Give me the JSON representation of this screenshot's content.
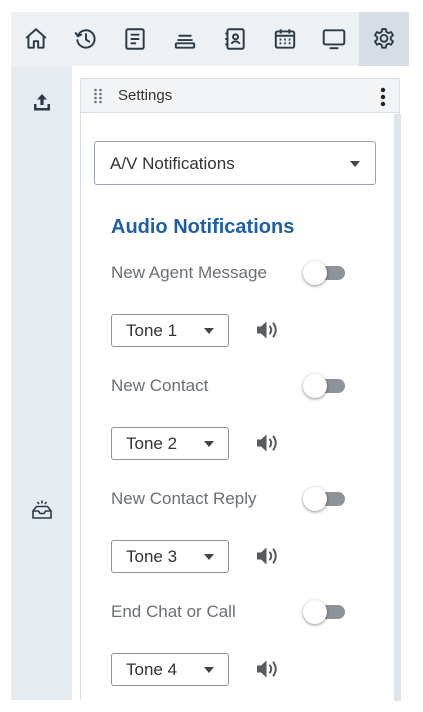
{
  "toolbar": {
    "icons": [
      "home-icon",
      "history-icon",
      "notes-icon",
      "queue-icon",
      "contacts-icon",
      "calendar-icon",
      "monitor-icon",
      "gear-icon"
    ],
    "active": "gear-icon"
  },
  "rail": {
    "icons": [
      "upload-icon",
      "inbox-icon"
    ]
  },
  "panel": {
    "title": "Settings",
    "menu_icon": "more-vertical-icon"
  },
  "category_select": {
    "value": "A/V Notifications"
  },
  "audio": {
    "heading": "Audio Notifications",
    "items": [
      {
        "label": "New Agent Message",
        "enabled": false,
        "tone": "Tone 1"
      },
      {
        "label": "New Contact",
        "enabled": false,
        "tone": "Tone 2"
      },
      {
        "label": "New Contact Reply",
        "enabled": false,
        "tone": "Tone 3"
      },
      {
        "label": "End Chat or Call",
        "enabled": false,
        "tone": "Tone 4"
      }
    ]
  },
  "colors": {
    "accent": "#1f5fa8",
    "toolbar_bg": "#eef1f4",
    "active_bg": "#d6dde4"
  }
}
